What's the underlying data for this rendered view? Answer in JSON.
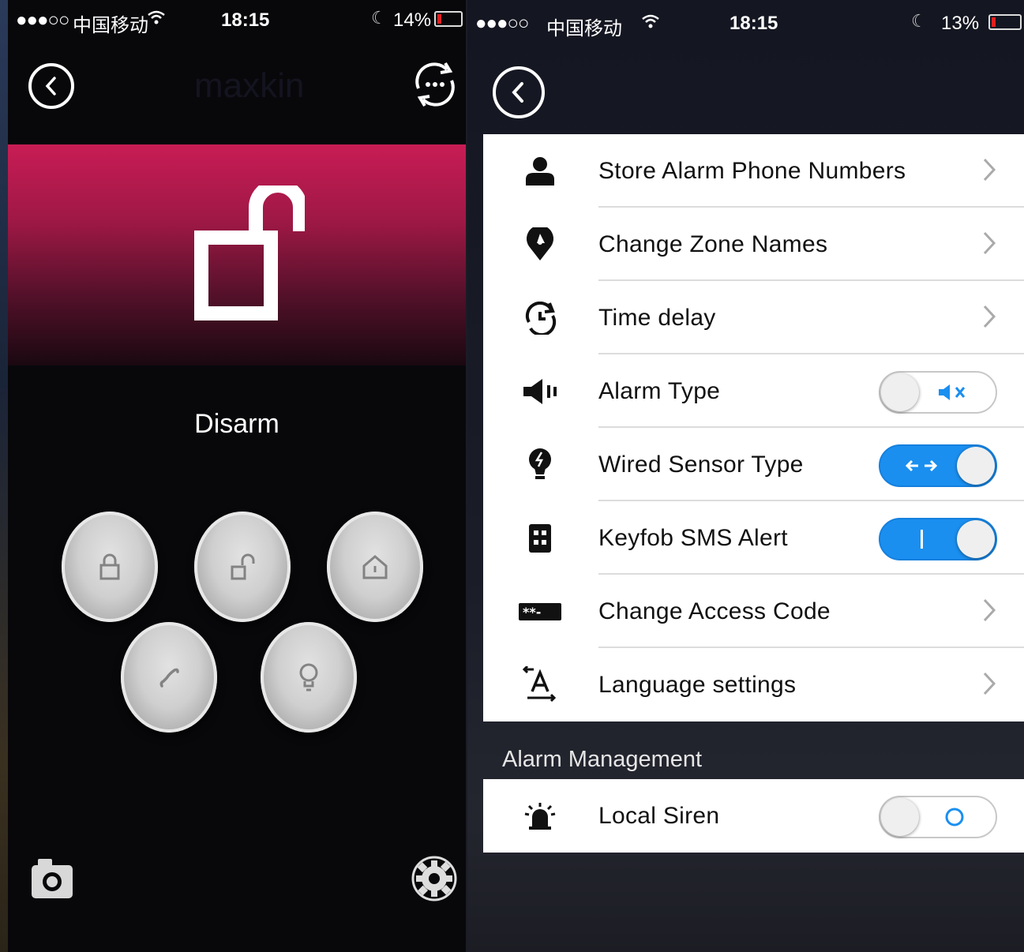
{
  "left_phone": {
    "status": {
      "signal": "●●●○○",
      "carrier": "中国移动",
      "time": "18:15",
      "battery": "14%"
    },
    "header_title": "maxkin",
    "state_label": "Disarm",
    "buttons": [
      "lock-icon",
      "unlock-icon",
      "home-icon",
      "phone-icon",
      "bulb-icon"
    ],
    "accent": "#c81c55"
  },
  "right_phone": {
    "status": {
      "signal": "●●●○○",
      "carrier": "中国移动",
      "time": "18:15",
      "battery": "13%"
    },
    "settings": [
      {
        "label": "Store Alarm Phone Numbers",
        "icon": "person-icon",
        "control": "chevron"
      },
      {
        "label": "Change Zone Names",
        "icon": "location-pin-icon",
        "control": "chevron"
      },
      {
        "label": "Time delay",
        "icon": "clock-refresh-icon",
        "control": "chevron"
      },
      {
        "label": "Alarm Type",
        "icon": "speaker-icon",
        "control": "toggle",
        "on": false,
        "toggle_glyph": "mute"
      },
      {
        "label": "Wired Sensor Type",
        "icon": "lightbulb-icon",
        "control": "toggle",
        "on": true,
        "toggle_glyph": "arrows"
      },
      {
        "label": "Keyfob SMS Alert",
        "icon": "keyfob-icon",
        "control": "toggle",
        "on": true,
        "toggle_glyph": "bar"
      },
      {
        "label": "Change Access Code",
        "icon": "password-icon",
        "control": "chevron"
      },
      {
        "label": "Language settings",
        "icon": "text-direction-icon",
        "control": "chevron"
      }
    ],
    "section_title": "Alarm Management",
    "management": [
      {
        "label": "Local Siren",
        "icon": "siren-icon",
        "control": "toggle",
        "on": false,
        "toggle_glyph": "circle"
      }
    ],
    "toggle_on_color": "#1a8ff0"
  }
}
